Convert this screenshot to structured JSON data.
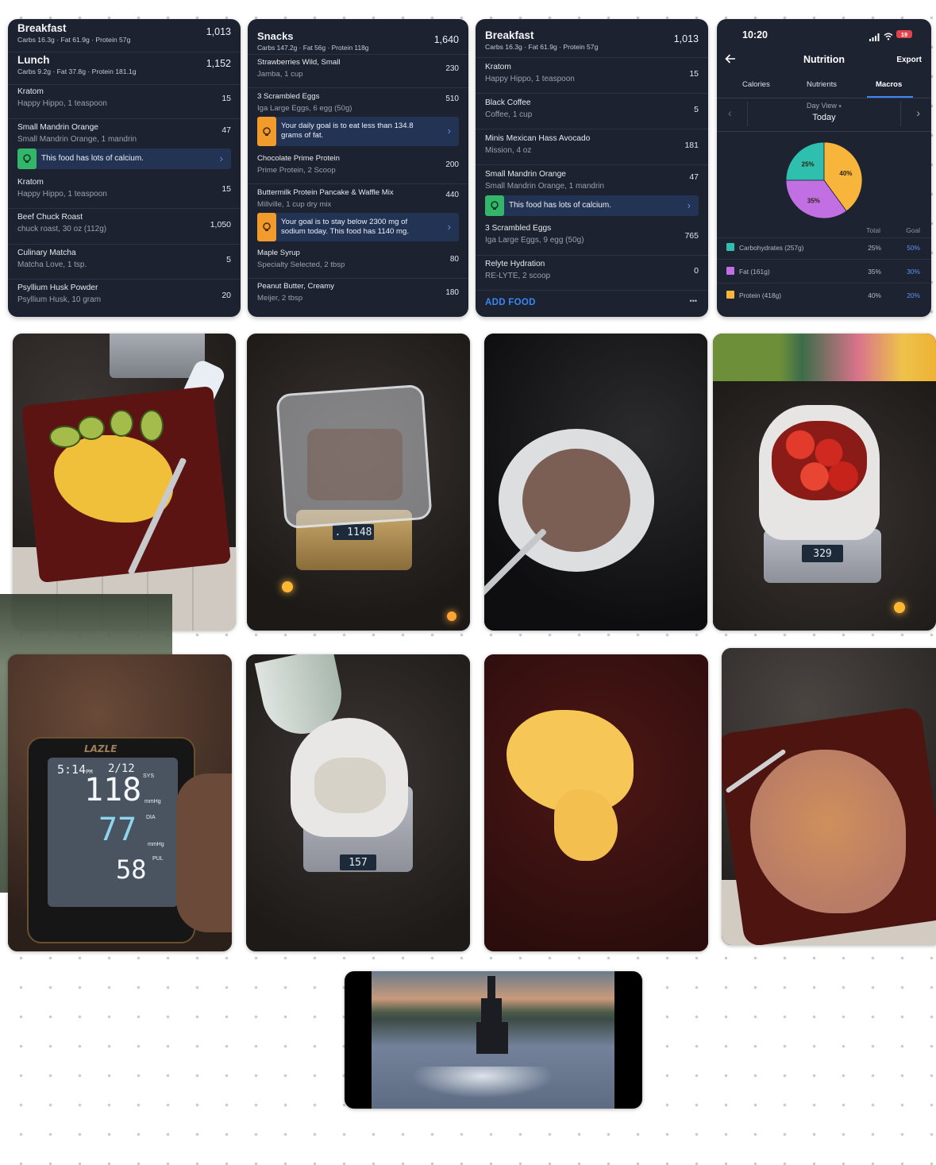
{
  "card1": {
    "breakfast": {
      "title": "Breakfast",
      "kcal": "1,013",
      "macros": "Carbs 16.3g · Fat 61.9g · Protein 57g"
    },
    "lunch": {
      "title": "Lunch",
      "kcal": "1,152",
      "macros": "Carbs 9.2g · Fat 37.8g · Protein 181.1g"
    },
    "items": [
      {
        "name": "Kratom",
        "sub": "Happy Hippo, 1 teaspoon",
        "kcal": "15"
      },
      {
        "name": "Small Mandrin Orange",
        "sub": "Small Mandrin Orange, 1 mandrin",
        "kcal": "47"
      },
      {
        "name": "Kratom",
        "sub": "Happy Hippo, 1 teaspoon",
        "kcal": "15"
      },
      {
        "name": "Beef Chuck Roast",
        "sub": "chuck roast, 30 oz (112g)",
        "kcal": "1,050"
      },
      {
        "name": "Culinary Matcha",
        "sub": "Matcha Love, 1 tsp.",
        "kcal": "5"
      },
      {
        "name": "Psyllium Husk Powder",
        "sub": "Psyllium Husk, 10 gram",
        "kcal": "20"
      }
    ],
    "banner": "This food has lots of calcium."
  },
  "card2": {
    "snacks": {
      "title": "Snacks",
      "kcal": "1,640",
      "macros": "Carbs 147.2g · Fat 56g · Protein 118g"
    },
    "items": [
      {
        "name": "Strawberries Wild, Small",
        "sub": "Jamba, 1 cup",
        "kcal": "230"
      },
      {
        "name": "3 Scrambled Eggs",
        "sub": "Iga Large Eggs, 6 egg (50g)",
        "kcal": "510"
      },
      {
        "name": "Chocolate  Prime Protein",
        "sub": "Prime Protein, 2 Scoop",
        "kcal": "200"
      },
      {
        "name": "Buttermilk Protein Pancake & Waffle Mix",
        "sub": "Millville, 1 cup dry mix",
        "kcal": "440"
      },
      {
        "name": "Maple Syrup",
        "sub": "Specialty Selected, 2 tbsp",
        "kcal": "80"
      },
      {
        "name": "Peanut Butter, Creamy",
        "sub": "Meijer, 2 tbsp",
        "kcal": "180"
      }
    ],
    "banner_fat": [
      "Your daily goal is to eat less than 134.8",
      "grams of fat."
    ],
    "banner_sodium": [
      "Your goal is to stay below 2300 mg of",
      "sodium today. This food has 1140 mg."
    ]
  },
  "card3": {
    "breakfast": {
      "title": "Breakfast",
      "kcal": "1,013",
      "macros": "Carbs 16.3g · Fat 61.9g · Protein 57g"
    },
    "items": [
      {
        "name": "Kratom",
        "sub": "Happy Hippo, 1 teaspoon",
        "kcal": "15"
      },
      {
        "name": "Black Coffee",
        "sub": "Coffee, 1 cup",
        "kcal": "5"
      },
      {
        "name": "Minis Mexican Hass Avocado",
        "sub": "Mission, 4 oz",
        "kcal": "181"
      },
      {
        "name": "Small Mandrin Orange",
        "sub": "Small Mandrin Orange, 1 mandrin",
        "kcal": "47"
      },
      {
        "name": "3 Scrambled Eggs",
        "sub": "Iga Large Eggs, 9 egg (50g)",
        "kcal": "765"
      },
      {
        "name": "Relyte Hydration",
        "sub": "RE-LYTE, 2 scoop",
        "kcal": "0"
      }
    ],
    "banner": "This food has lots of calcium.",
    "add_food": "ADD FOOD",
    "more": "•••"
  },
  "nutrition": {
    "time": "10:20",
    "battery": "19",
    "title": "Nutrition",
    "export": "Export",
    "tabs": [
      "Calories",
      "Nutrients",
      "Macros"
    ],
    "active_tab": "Macros",
    "day_view": "Day View",
    "today": "Today",
    "col_total": "Total",
    "col_goal": "Goal",
    "pie": [
      {
        "label": "25%",
        "value": 25,
        "color": "#2ebfae"
      },
      {
        "label": "40%",
        "value": 40,
        "color": "#f8b53b"
      },
      {
        "label": "35%",
        "value": 35,
        "color": "#c26fe3"
      }
    ],
    "legend": [
      {
        "name": "Carbohydrates (257g)",
        "total": "25%",
        "goal": "50%",
        "color": "#2ebfae"
      },
      {
        "name": "Fat (161g)",
        "total": "35%",
        "goal": "30%",
        "color": "#c26fe3"
      },
      {
        "name": "Protein (418g)",
        "total": "40%",
        "goal": "20%",
        "color": "#f8b53b"
      }
    ]
  },
  "photos": {
    "scale_1148": ". 1148",
    "scale_329": "329",
    "scale_157": "157",
    "bp_brand": "LAZLE",
    "bp_time": "5:14",
    "bp_time_suffix": "PM",
    "bp_date": "2/12",
    "bp_sys": "118",
    "bp_dia": "77",
    "bp_pul": "58",
    "bp_sys_label": "SYS",
    "bp_dia_label": "DIA",
    "bp_pul_label": "PUL",
    "bp_unit": "mmHg"
  }
}
